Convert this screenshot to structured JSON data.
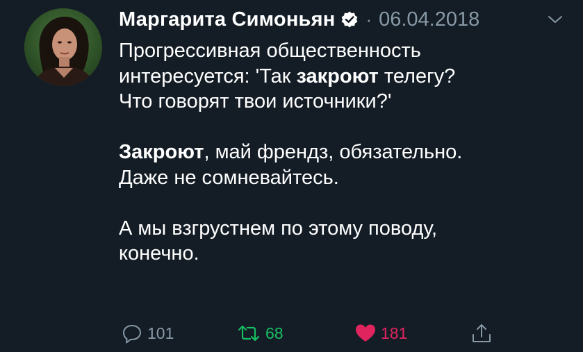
{
  "tweet": {
    "author_name": "Маргарита Симоньян",
    "separator": "·",
    "date": "06.04.2018",
    "lines": [
      {
        "parts": [
          "Прогрессивная общественность"
        ]
      },
      {
        "parts": [
          "интересуется: 'Так ",
          "закроют",
          " телегу?"
        ]
      },
      {
        "parts": [
          "Что говорят твои источники?'"
        ]
      },
      {
        "parts": []
      },
      {
        "parts": [
          "Закроют",
          ", май френдз, обязательно."
        ]
      },
      {
        "parts": [
          "Даже не сомневайтесь."
        ]
      },
      {
        "parts": []
      },
      {
        "parts": [
          "А мы взгрустнем по этому поводу,"
        ]
      },
      {
        "parts": [
          "конечно."
        ]
      }
    ],
    "actions": {
      "reply_count": "101",
      "retweet_count": "68",
      "like_count": "181"
    }
  },
  "icons": {
    "avatar": "avatar-photo",
    "verified": "verified-badge-icon",
    "menu": "chevron-down-icon",
    "reply": "reply-icon",
    "retweet": "retweet-icon",
    "like": "heart-icon",
    "share": "share-icon"
  },
  "colors": {
    "background": "#141d26",
    "text": "#ffffff",
    "muted": "#8899a6",
    "retweet": "#17bf63",
    "like": "#e0245e"
  }
}
